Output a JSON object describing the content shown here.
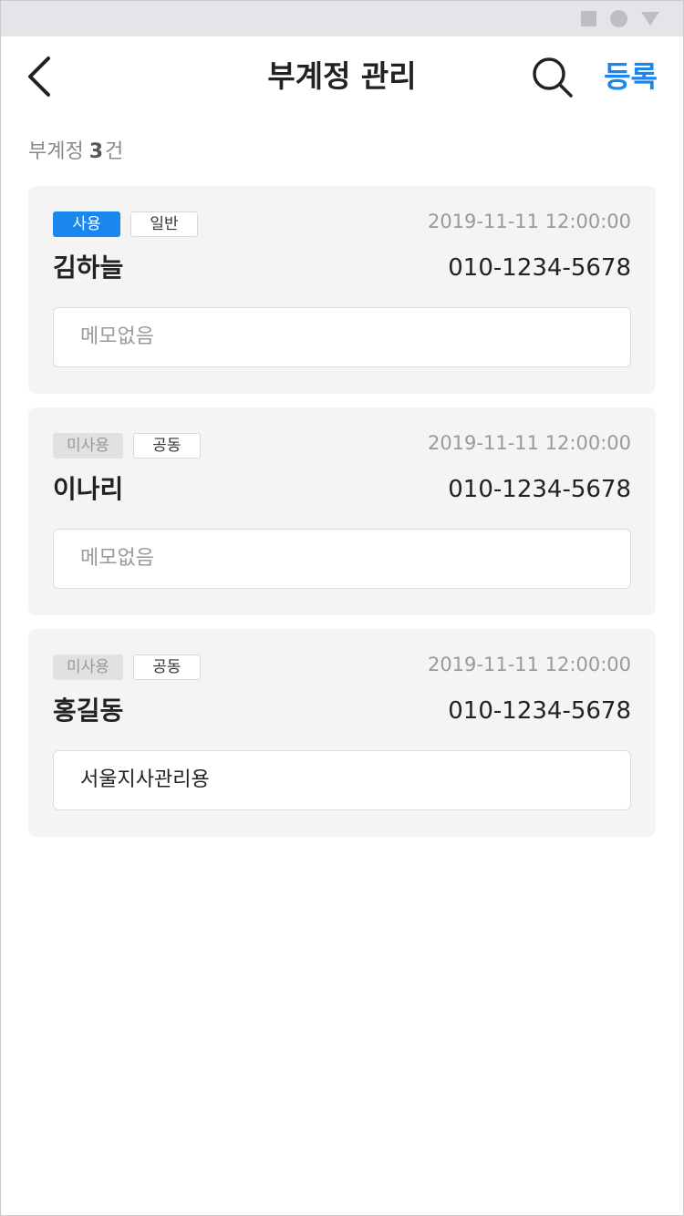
{
  "header": {
    "title": "부계정 관리",
    "register_label": "등록",
    "back_icon": "chevron-left-icon",
    "search_icon": "search-icon"
  },
  "summary": {
    "label": "부계정",
    "count": "3",
    "unit": "건"
  },
  "accounts": [
    {
      "status": "사용",
      "status_active": true,
      "type": "일반",
      "datetime": "2019-11-11 12:00:00",
      "name": "김하늘",
      "phone": "010-1234-5678",
      "memo": "메모없음",
      "memo_empty": true
    },
    {
      "status": "미사용",
      "status_active": false,
      "type": "공동",
      "datetime": "2019-11-11 12:00:00",
      "name": "이나리",
      "phone": "010-1234-5678",
      "memo": "메모없음",
      "memo_empty": true
    },
    {
      "status": "미사용",
      "status_active": false,
      "type": "공동",
      "datetime": "2019-11-11 12:00:00",
      "name": "홍길동",
      "phone": "010-1234-5678",
      "memo": "서울지사관리용",
      "memo_empty": false
    }
  ],
  "colors": {
    "accent": "#1a86f0",
    "card_background": "#f4f4f4",
    "status_bar": "#e4e5e9",
    "inactive_badge": "#e1e1e1"
  }
}
